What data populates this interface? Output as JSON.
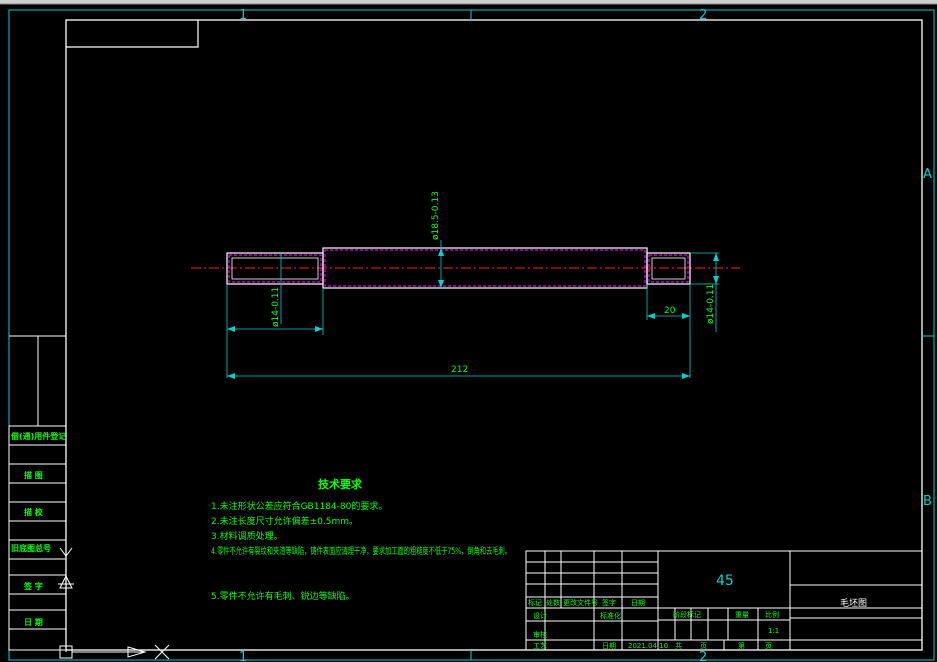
{
  "zones": {
    "top_left": "1",
    "top_right": "2",
    "bottom_left": "1",
    "bottom_right": "2",
    "row_a": "A",
    "row_b": "B"
  },
  "dimensions": {
    "main_diameter": "ø18.5-0.13",
    "left_diameter": "ø14-0.11",
    "right_diameter": "ø14-0.11",
    "right_length": "20",
    "total_length": "212"
  },
  "sidebar_labels": [
    "借(通)用件登记",
    "描 图",
    "描 校",
    "旧底图总号",
    "签 字",
    "日 期"
  ],
  "tech_notes": {
    "title": "技术要求",
    "lines": [
      "1.未注形状公差应符合GB1184-80的要求。",
      "2.未注长度尺寸允许偏差±0.5mm。",
      "3.材料调质处理。",
      "4.零件不允许有裂纹和夹渣等缺陷，铸件表面应清理干净，要求加工面的粗糙度不低于75%，倒角和去毛刺。",
      "5.零件不允许有毛刺、锐边等缺陷。"
    ]
  },
  "title_block": {
    "material": "45",
    "drawing_name": "毛坯图",
    "scale": "1:1",
    "date": "2021.04.10",
    "labels": {
      "mark": "标记",
      "count": "处数",
      "change_doc": "更改文件号",
      "sign": "签字",
      "date_label": "日期",
      "design": "设计",
      "standardization": "标准化",
      "review": "审核",
      "process": "工艺",
      "stage_mark": "阶段标记",
      "weight": "重量",
      "scale_label": "比例",
      "total": "共",
      "sheet": "第",
      "page": "页"
    }
  }
}
